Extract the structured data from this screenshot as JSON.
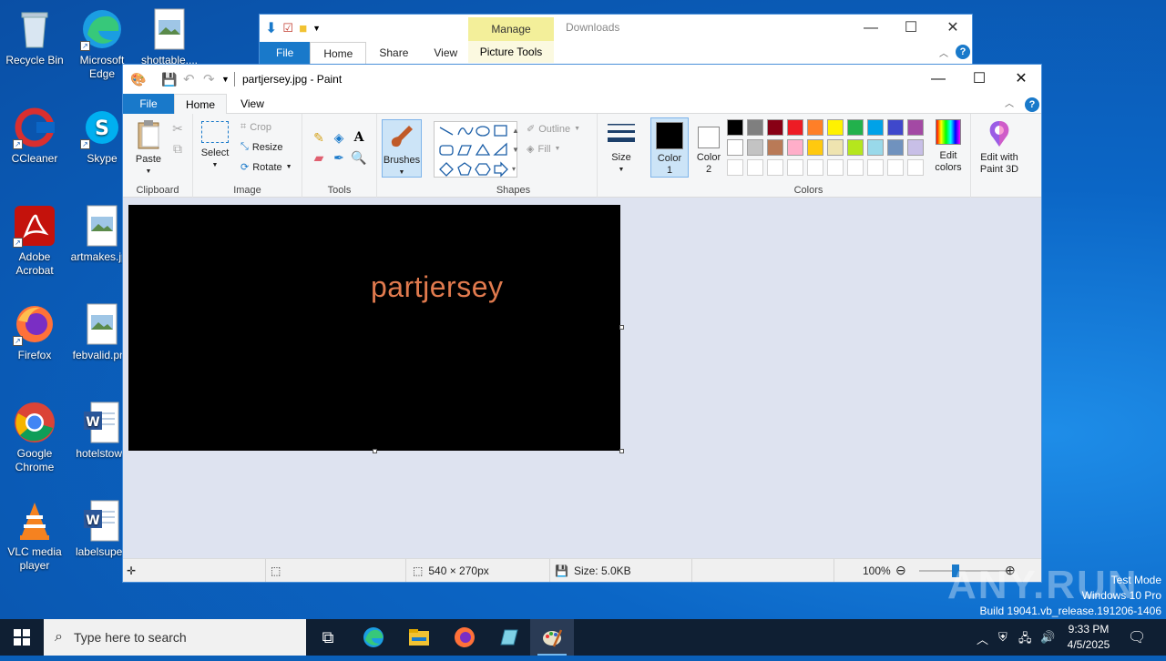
{
  "desktop": {
    "icons": [
      {
        "label": "Recycle Bin",
        "icon": "recycle-bin-icon"
      },
      {
        "label": "Microsoft Edge",
        "icon": "edge-icon"
      },
      {
        "label": "shottable....",
        "icon": "image-file-icon"
      },
      {
        "label": "CCleaner",
        "icon": "ccleaner-icon"
      },
      {
        "label": "Skype",
        "icon": "skype-icon"
      },
      {
        "label": "Adobe Acrobat",
        "icon": "acrobat-icon"
      },
      {
        "label": "artmakes.jpg",
        "icon": "image-file-icon"
      },
      {
        "label": "Firefox",
        "icon": "firefox-icon"
      },
      {
        "label": "febvalid.png",
        "icon": "image-file-icon"
      },
      {
        "label": "Google Chrome",
        "icon": "chrome-icon"
      },
      {
        "label": "hotelstown",
        "icon": "word-file-icon"
      },
      {
        "label": "VLC media player",
        "icon": "vlc-icon"
      },
      {
        "label": "labelsuper.",
        "icon": "word-file-icon"
      }
    ]
  },
  "explorer": {
    "title": "Downloads",
    "manage": "Manage",
    "tabs": [
      "File",
      "Home",
      "Share",
      "View"
    ],
    "picture_tools": "Picture Tools"
  },
  "paint": {
    "title": "partjersey.jpg - Paint",
    "tabs": {
      "file": "File",
      "home": "Home",
      "view": "View"
    },
    "groups": {
      "clipboard": {
        "label": "Clipboard",
        "paste": "Paste"
      },
      "image": {
        "label": "Image",
        "select": "Select",
        "crop": "Crop",
        "resize": "Resize",
        "rotate": "Rotate"
      },
      "tools": {
        "label": "Tools"
      },
      "brushes": {
        "label": "Brushes"
      },
      "shapes": {
        "label": "Shapes",
        "outline": "Outline",
        "fill": "Fill"
      },
      "size": {
        "label": "Size"
      },
      "colors": {
        "label": "Colors",
        "color1": "Color 1",
        "color2": "Color 2",
        "edit_colors": "Edit colors"
      },
      "paint3d": {
        "label": "Edit with Paint 3D"
      }
    },
    "palette_row1": [
      "#000000",
      "#7f7f7f",
      "#880015",
      "#ed1c24",
      "#ff7f27",
      "#fff200",
      "#22b14c",
      "#00a2e8",
      "#3f48cc",
      "#a349a4"
    ],
    "palette_row2": [
      "#ffffff",
      "#c3c3c3",
      "#b97a57",
      "#ffaec9",
      "#ffc90e",
      "#efe4b0",
      "#b5e61d",
      "#99d9ea",
      "#7092be",
      "#c8bfe7"
    ],
    "color1_value": "#000000",
    "color2_value": "#ffffff",
    "canvas_text": "partjersey",
    "canvas_text_color": "#e07a4e",
    "status": {
      "dimensions": "540 × 270px",
      "size": "Size: 5.0KB",
      "zoom": "100%"
    }
  },
  "taskbar": {
    "search_placeholder": "Type here to search",
    "time": "9:33 PM",
    "date": "4/5/2025"
  },
  "watermark": {
    "line1": "Test Mode",
    "line2": "Windows 10 Pro",
    "line3": "Build 19041.vb_release.191206-1406",
    "brand": "ANY.RUN"
  }
}
